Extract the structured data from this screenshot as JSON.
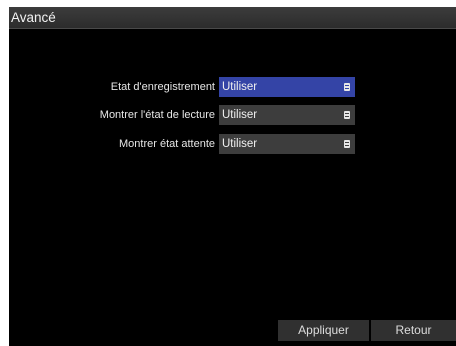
{
  "window": {
    "title": "Avancé"
  },
  "settings": [
    {
      "label": "Etat d'enregistrement",
      "value": "Utiliser",
      "focused": true
    },
    {
      "label": "Montrer l'état de lecture",
      "value": "Utiliser",
      "focused": false
    },
    {
      "label": "Montrer état attente",
      "value": "Utiliser",
      "focused": false
    }
  ],
  "footer": {
    "apply_label": "Appliquer",
    "back_label": "Retour"
  },
  "colors": {
    "focus_blue": "#3444a6",
    "field_gray": "#3d3d3d",
    "background": "#000000"
  },
  "icons": {
    "dropdown": "dropdown-icon"
  }
}
